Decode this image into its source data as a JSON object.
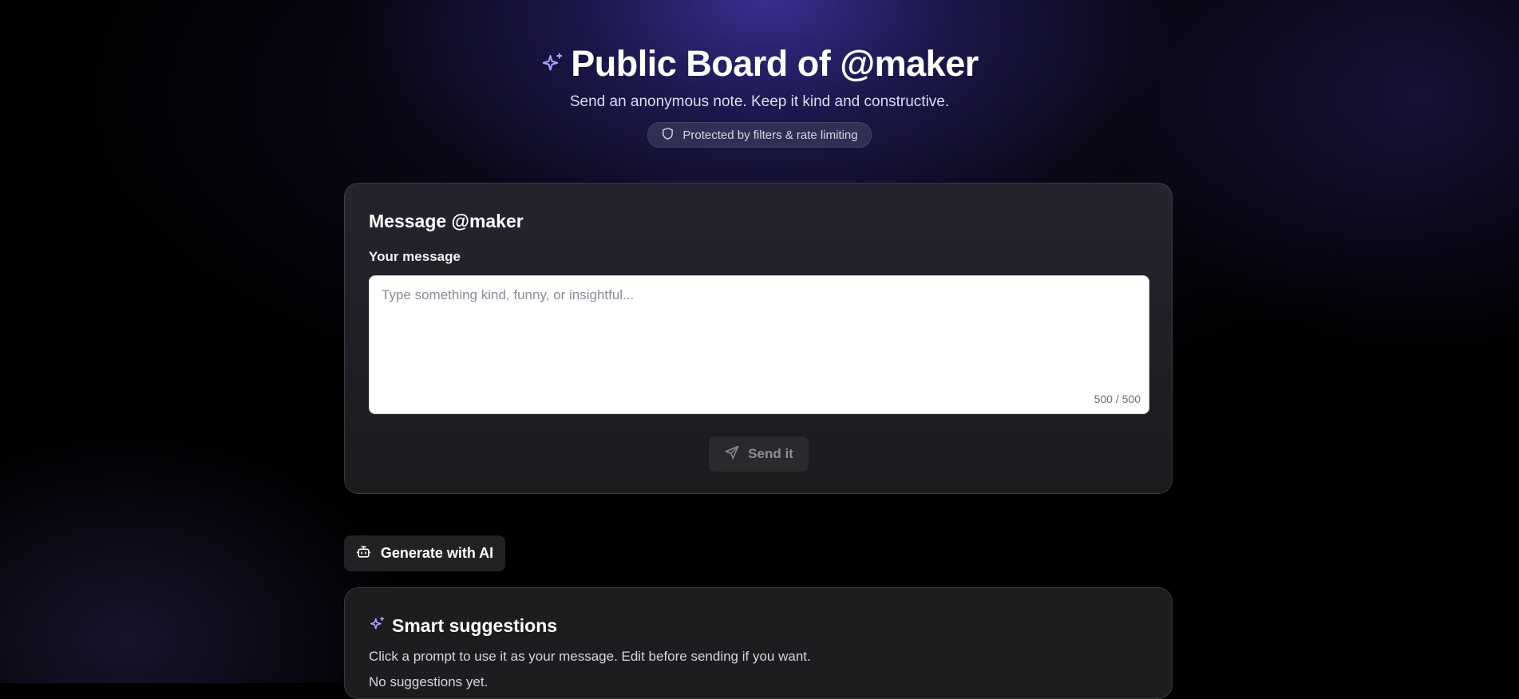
{
  "header": {
    "title": "Public Board of @maker",
    "subtitle": "Send an anonymous note. Keep it kind and constructive.",
    "badge": "Protected by filters & rate limiting",
    "accent_color": "#a7a6ff"
  },
  "message_card": {
    "title": "Message @maker",
    "field_label": "Your message",
    "placeholder": "Type something kind, funny, or insightful...",
    "value": "",
    "counter": "500 / 500",
    "send_label": "Send it"
  },
  "ai_button": {
    "label": "Generate with AI"
  },
  "suggestions": {
    "title": "Smart suggestions",
    "subtitle": "Click a prompt to use it as your message. Edit before sending if you want.",
    "empty_text": "No suggestions yet."
  }
}
